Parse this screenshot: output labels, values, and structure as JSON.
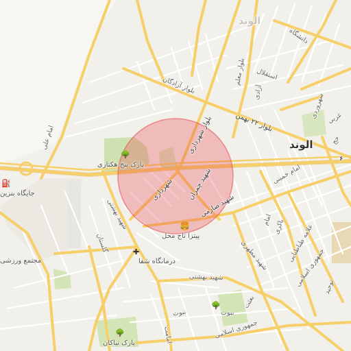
{
  "map": {
    "center_circle_color": "#e7474b",
    "road_major_color": "#f6cf68",
    "road_minor_color": "#ffffff",
    "park_color": "#cfe1b0",
    "labels": {
      "city_main": "الوند",
      "city_faded": "الوند",
      "daneshgah": "دانشگاه",
      "moallem": "بلوار معلم",
      "esteghlal": "استقلال",
      "azadi": "آزادی",
      "azadegan": "بلوار آزادگان",
      "bahman": "بلوار ۲۲ بهمن",
      "sohrevardi": "سهروردی",
      "gharbi": "غربی",
      "imam_ali": "امام علی",
      "shahrdari_1": "بلوار شهرداری",
      "shahrdari_2": "شهرداری",
      "chamran": "شهید چمران",
      "saremi": "شهید صارمی",
      "imam_khomeini": "امام خمینی",
      "golestan": "گلستان",
      "shahid_beheshti_v": "شهید بهشتی",
      "motahari": "شهید مطهری",
      "imam_khomeini_2": "امام",
      "dakhil": "باکری",
      "alamehtabatabaei": "علامه طباطبایی",
      "jomhouri_1": "جمهوری اسلامی",
      "shahid_beheshti_h": "شهید بهشتی",
      "tohid": "توحید",
      "nobout_1": "نبوت",
      "nobout_2": "نبوت",
      "besat": "بعثت",
      "jomhouri_2": "جمهوری اسلامی",
      "emamat": "امامت",
      "haj": "حج",
      "route_num": "۶"
    },
    "pois": {
      "park_hectari": "پارک پنج هکتاری",
      "gas_station": "جایگاه بنزین",
      "sports_complex": "مجتمع ورزشی",
      "pizza": "پیتزا تاج محل",
      "clinic": "درمانگاه شفا",
      "park_niakan": "پارک نیاکان"
    },
    "icons": {
      "park": "tree-icon",
      "fuel": "fuel-icon",
      "food": "burger-icon",
      "clinic": "cross-icon"
    }
  }
}
